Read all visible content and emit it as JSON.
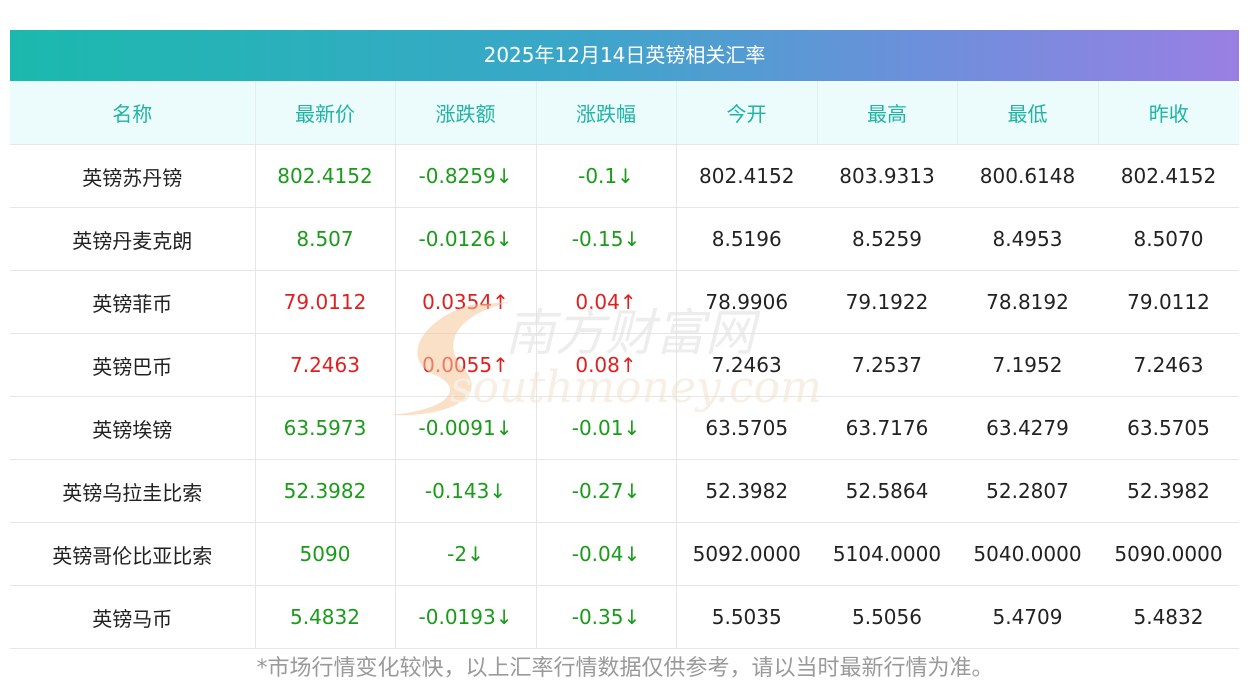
{
  "title": "2025年12月14日英镑相关汇率",
  "headers": [
    "名称",
    "最新价",
    "涨跌额",
    "涨跌幅",
    "今开",
    "最高",
    "最低",
    "昨收"
  ],
  "rows": [
    {
      "name": "英镑苏丹镑",
      "latest": "802.4152",
      "change": "-0.8259↓",
      "pct": "-0.1↓",
      "open": "802.4152",
      "high": "803.9313",
      "low": "800.6148",
      "prev": "802.4152",
      "dir": "down"
    },
    {
      "name": "英镑丹麦克朗",
      "latest": "8.507",
      "change": "-0.0126↓",
      "pct": "-0.15↓",
      "open": "8.5196",
      "high": "8.5259",
      "low": "8.4953",
      "prev": "8.5070",
      "dir": "down"
    },
    {
      "name": "英镑菲币",
      "latest": "79.0112",
      "change": "0.0354↑",
      "pct": "0.04↑",
      "open": "78.9906",
      "high": "79.1922",
      "low": "78.8192",
      "prev": "79.0112",
      "dir": "up"
    },
    {
      "name": "英镑巴币",
      "latest": "7.2463",
      "change": "0.0055↑",
      "pct": "0.08↑",
      "open": "7.2463",
      "high": "7.2537",
      "low": "7.1952",
      "prev": "7.2463",
      "dir": "up"
    },
    {
      "name": "英镑埃镑",
      "latest": "63.5973",
      "change": "-0.0091↓",
      "pct": "-0.01↓",
      "open": "63.5705",
      "high": "63.7176",
      "low": "63.4279",
      "prev": "63.5705",
      "dir": "down"
    },
    {
      "name": "英镑乌拉圭比索",
      "latest": "52.3982",
      "change": "-0.143↓",
      "pct": "-0.27↓",
      "open": "52.3982",
      "high": "52.5864",
      "low": "52.2807",
      "prev": "52.3982",
      "dir": "down"
    },
    {
      "name": "英镑哥伦比亚比索",
      "latest": "5090",
      "change": "-2↓",
      "pct": "-0.04↓",
      "open": "5092.0000",
      "high": "5104.0000",
      "low": "5040.0000",
      "prev": "5090.0000",
      "dir": "down"
    },
    {
      "name": "英镑马币",
      "latest": "5.4832",
      "change": "-0.0193↓",
      "pct": "-0.35↓",
      "open": "5.5035",
      "high": "5.5056",
      "low": "5.4709",
      "prev": "5.4832",
      "dir": "down"
    }
  ],
  "colors": {
    "up": "#e02020",
    "down": "#1a9b1a",
    "header_text": "#1fb4a4"
  },
  "watermark": {
    "cn": "南方财富网",
    "en": "southmoney.com"
  },
  "footnote": "*市场行情变化较快，以上汇率行情数据仅供参考，请以当时最新行情为准。"
}
